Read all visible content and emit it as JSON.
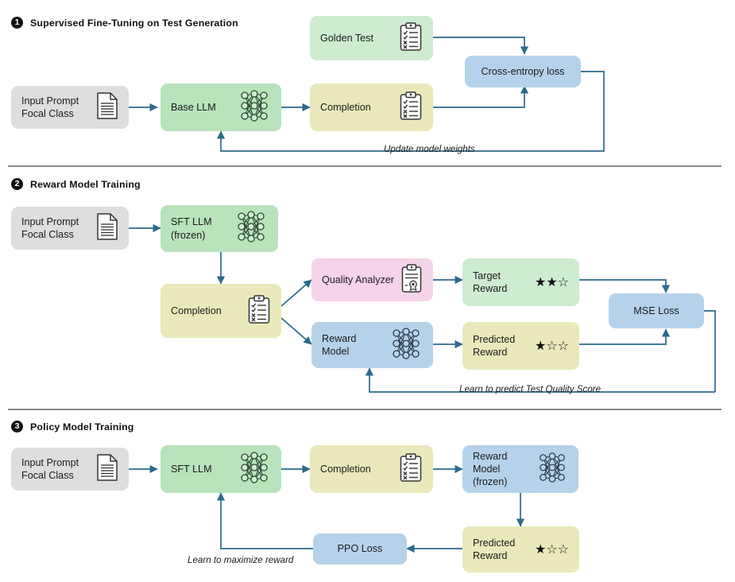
{
  "figure": {
    "accent_line_color": "#2b6a8b",
    "divider_color": "#8a8a8a",
    "palette": {
      "gray": "#dededd",
      "green_light": "#cdecd0",
      "green_mid": "#b8e3bb",
      "yellow": "#e9e9bb",
      "blue": "#b6d2ea",
      "pink": "#f5d3e8"
    }
  },
  "sections": [
    {
      "number": "1",
      "title": "Supervised Fine-Tuning on Test Generation"
    },
    {
      "number": "2",
      "title": "Reward Model Training"
    },
    {
      "number": "3",
      "title": "Policy Model Training"
    }
  ],
  "section1": {
    "input": {
      "label": "Input Prompt\nFocal Class",
      "icon": "document-icon"
    },
    "base_llm": {
      "label": "Base LLM",
      "icon": "neural-network-icon"
    },
    "completion": {
      "label": "Completion",
      "icon": "clipboard-checklist-icon"
    },
    "golden_test": {
      "label": "Golden Test",
      "icon": "clipboard-checklist-icon"
    },
    "loss": {
      "label": "Cross-entropy loss"
    },
    "feedback_caption": "Update model weights"
  },
  "section2": {
    "input": {
      "label": "Input Prompt\nFocal Class",
      "icon": "document-icon"
    },
    "sft_llm": {
      "label": "SFT LLM\n(frozen)",
      "icon": "neural-network-icon"
    },
    "completion": {
      "label": "Completion",
      "icon": "clipboard-checklist-icon"
    },
    "quality_analyzer": {
      "label": "Quality Analyzer",
      "icon": "clipboard-award-icon"
    },
    "reward_model": {
      "label": "Reward Model",
      "icon": "neural-network-icon"
    },
    "target_reward": {
      "label": "Target\nReward",
      "stars": "★★☆",
      "rating": 2,
      "max_rating": 3
    },
    "predicted_reward": {
      "label": "Predicted\nReward",
      "stars": "★☆☆",
      "rating": 1,
      "max_rating": 3
    },
    "loss": {
      "label": "MSE Loss"
    },
    "feedback_caption": "Learn to predict Test Quality Score"
  },
  "section3": {
    "input": {
      "label": "Input Prompt\nFocal Class",
      "icon": "document-icon"
    },
    "sft_llm": {
      "label": "SFT LLM",
      "icon": "neural-network-icon"
    },
    "completion": {
      "label": "Completion",
      "icon": "clipboard-checklist-icon"
    },
    "reward_model": {
      "label": "Reward Model\n(frozen)",
      "icon": "neural-network-icon"
    },
    "predicted_reward": {
      "label": "Predicted\nReward",
      "stars": "★☆☆",
      "rating": 1,
      "max_rating": 3
    },
    "loss": {
      "label": "PPO Loss"
    },
    "feedback_caption": "Learn to maximize reward"
  }
}
